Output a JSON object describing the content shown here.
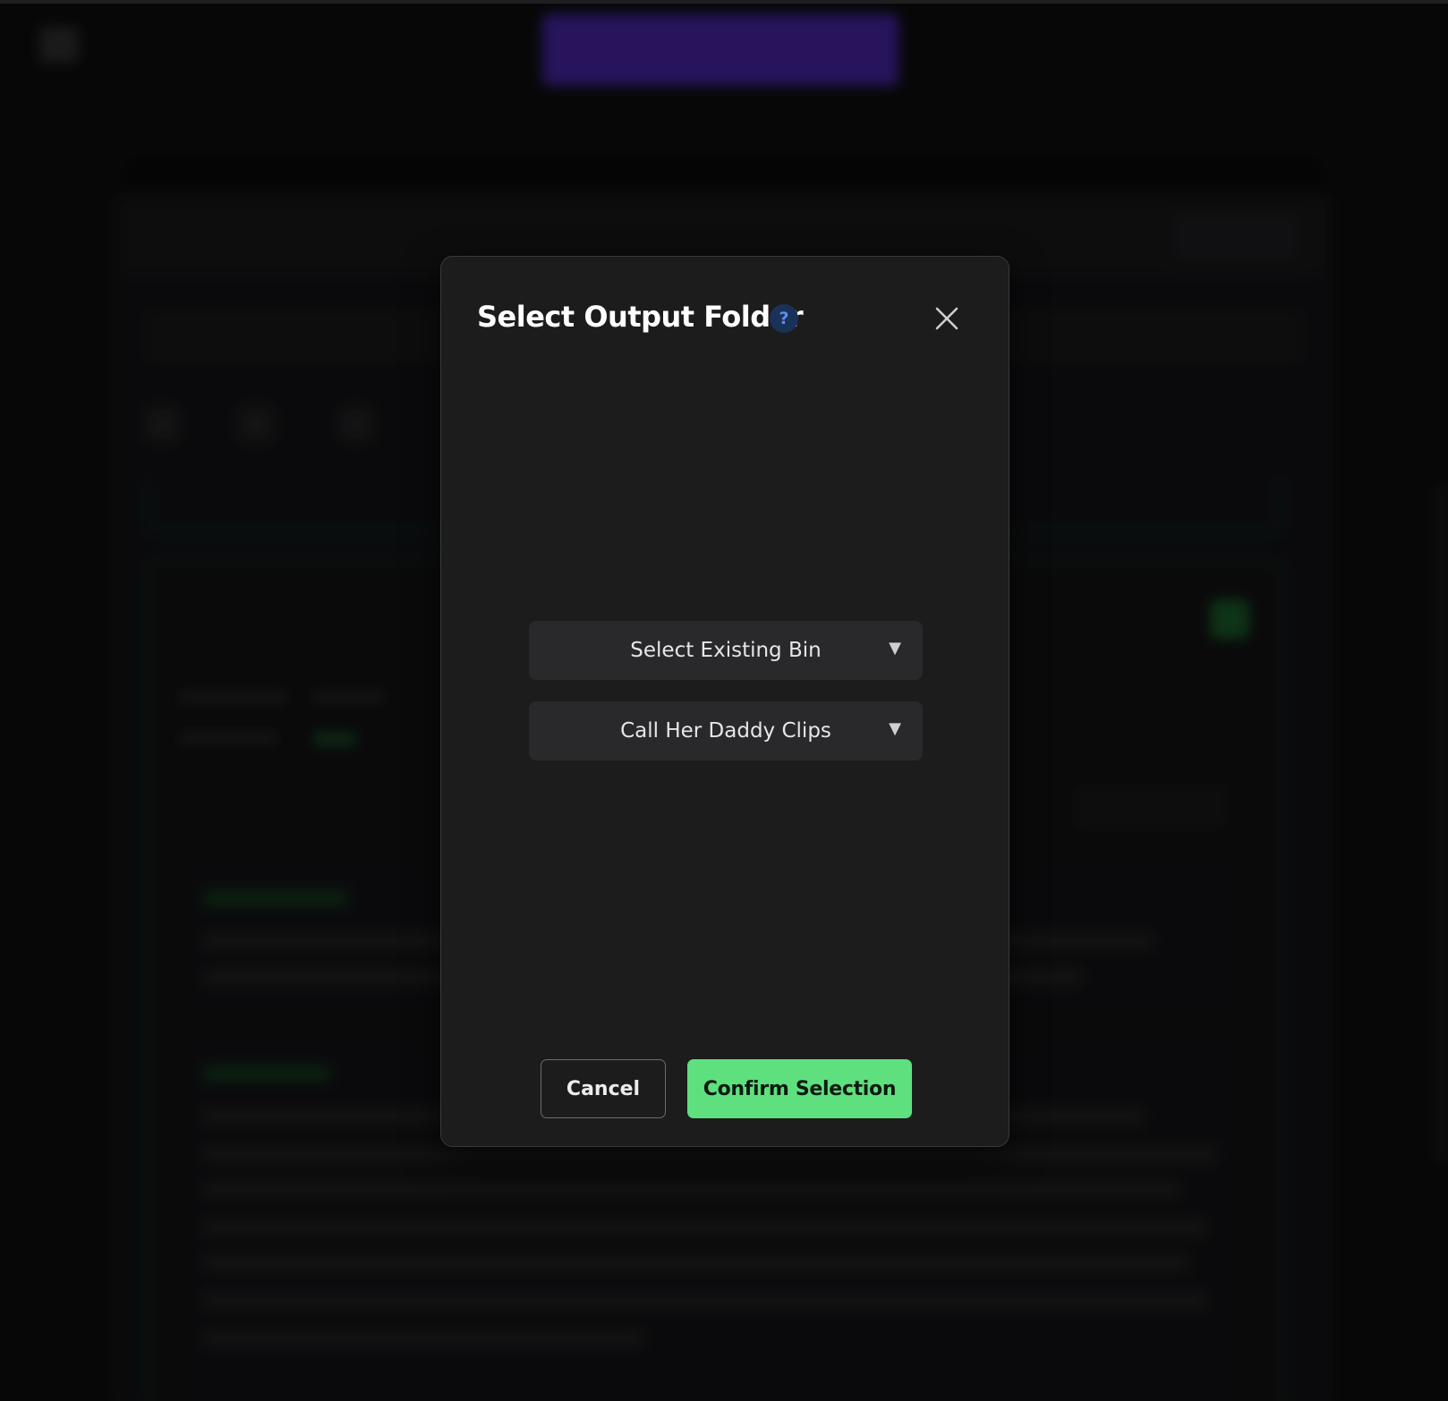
{
  "modal": {
    "title": "Select Output Folder",
    "help_glyph": "?",
    "close_icon": "close-icon",
    "bin_select": {
      "label": "Select Existing Bin",
      "arrow": "▼"
    },
    "folder_select": {
      "selected": "Call Her Daddy Clips",
      "arrow": "▼"
    },
    "cancel_label": "Cancel",
    "confirm_label": "Confirm Selection"
  },
  "colors": {
    "confirm_green": "#5ee07f",
    "help_blue": "#5b8ff0",
    "modal_bg": "#1c1c1d",
    "accent_purple": "#5a2be0"
  }
}
